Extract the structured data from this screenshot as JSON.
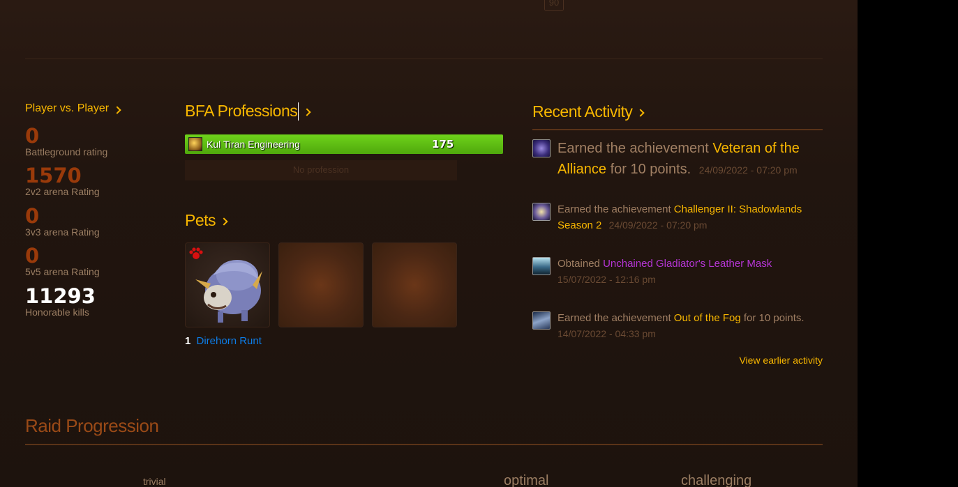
{
  "header": {
    "level_badge": "90"
  },
  "pvp": {
    "title": "Player vs. Player",
    "stats": [
      {
        "value": "0",
        "label": "Battleground rating"
      },
      {
        "value": "1570",
        "label": "2v2 arena Rating"
      },
      {
        "value": "0",
        "label": "3v3 arena Rating"
      },
      {
        "value": "0",
        "label": "5v5 arena Rating"
      },
      {
        "value": "11293",
        "label": "Honorable kills"
      }
    ]
  },
  "professions": {
    "title": "BFA Professions",
    "items": [
      {
        "name": "Kul Tiran Engineering",
        "value": "175",
        "icon": "engineering-icon",
        "color": "#5ab512"
      }
    ],
    "empty_label": "No profession"
  },
  "pets": {
    "title": "Pets",
    "featured": {
      "level": "1",
      "name": "Direhorn Runt",
      "icon": "direhorn-pet-icon",
      "family_icon": "paw-icon"
    }
  },
  "activity": {
    "title": "Recent Activity",
    "items": [
      {
        "prefix": "Earned the achievement",
        "link": "Veteran of the Alliance",
        "suffix": "for 10 points.",
        "timestamp": "24/09/2022 - 07:20 pm",
        "icon": "achievement-icon"
      },
      {
        "prefix": "Earned the achievement",
        "link": "Challenger II: Shadowlands Season 2",
        "suffix": "",
        "timestamp": "24/09/2022 - 07:20 pm",
        "icon": "achievement-icon"
      },
      {
        "prefix": "Obtained",
        "link": "Unchained Gladiator's Leather Mask",
        "suffix": "",
        "timestamp": "15/07/2022 - 12:16 pm",
        "icon": "item-helm-icon"
      },
      {
        "prefix": "Earned the achievement",
        "link": "Out of the Fog",
        "suffix": "for 10 points.",
        "timestamp": "14/07/2022 - 04:33 pm",
        "icon": "achievement-icon"
      }
    ],
    "view_earlier": "View earlier activity"
  },
  "raid": {
    "title": "Raid Progression",
    "columns": {
      "trivial": "trivial",
      "optimal": "optimal",
      "challenging": "challenging"
    }
  },
  "colors": {
    "accent": "#f8b700",
    "epic": "#b635d6",
    "pet_link": "#0d7de8",
    "pvp_value": "#9a3a0a"
  }
}
